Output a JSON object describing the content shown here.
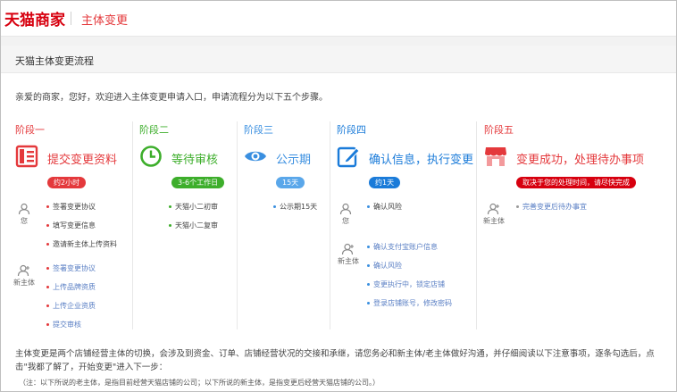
{
  "header": {
    "logo": "天猫商家",
    "subtitle": "主体变更"
  },
  "section": {
    "title": "天猫主体变更流程"
  },
  "intro": "亲爱的商家，您好，欢迎进入主体变更申请入口，申请流程分为以下五个步骤。",
  "colors": {
    "brand": "#d7000f",
    "stage1": "#e4393c",
    "stage2": "#3dae2b",
    "stage3": "#3a8fe0",
    "stage4": "#1a7bd9",
    "stage5": "#e4393c"
  },
  "stages": [
    {
      "label": "阶段一",
      "icon": "document-list-icon",
      "title": "提交变更资料",
      "badge": "约2小时",
      "actors": [
        {
          "name": "您",
          "items": [
            "签署变更协议",
            "填写变更信息",
            "邀请新主体上传资料"
          ]
        },
        {
          "name": "新主体",
          "items": [
            "签署变更协议",
            "上传品牌资质",
            "上传企业资质",
            "提交审核"
          ]
        }
      ]
    },
    {
      "label": "阶段二",
      "icon": "clock-icon",
      "title": "等待审核",
      "badge": "3-6个工作日",
      "items": [
        "天猫小二初审",
        "天猫小二复审"
      ]
    },
    {
      "label": "阶段三",
      "icon": "eye-icon",
      "title": "公示期",
      "badge": "15天",
      "items": [
        "公示期15天"
      ]
    },
    {
      "label": "阶段四",
      "icon": "edit-icon",
      "title": "确认信息，执行变更",
      "badge": "约1天",
      "actors": [
        {
          "name": "您",
          "items": [
            "确认风险"
          ]
        },
        {
          "name": "新主体",
          "items": [
            "确认支付宝账户信息",
            "确认风险",
            "变更执行中，锁定店铺",
            "登录店铺账号，修改密码"
          ]
        }
      ]
    },
    {
      "label": "阶段五",
      "icon": "shop-icon",
      "title": "变更成功，处理待办事项",
      "badge": "取决于您的处理时间，请尽快完成",
      "actors": [
        {
          "name": "新主体",
          "items": [
            "完善变更后待办事宜"
          ]
        }
      ]
    }
  ],
  "notice": "主体变更是两个店铺经营主体的切换，会涉及到资金、订单、店铺经营状况的交接和承继，请您务必和新主体/老主体做好沟通，并仔细阅读以下注意事项，逐条勾选后，点击\"我都了解了，开始变更\"进入下一步：",
  "note": "（注：以下所说的老主体，是指目前经营天猫店铺的公司；以下所说的新主体，是指变更后经营天猫店铺的公司。）"
}
